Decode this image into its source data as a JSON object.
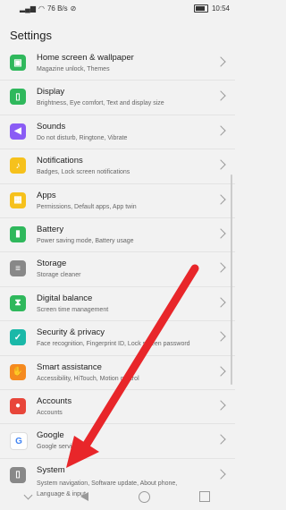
{
  "status": {
    "left_icons": "✦ ▮▮▮ ◉ 📶",
    "speed": "76 B/s",
    "battery_label": "",
    "time": "10:54"
  },
  "page_title": "Settings",
  "items": [
    {
      "label": "Home screen & wallpaper",
      "sub": "Magazine unlock, Themes",
      "color": "#2fb85c",
      "icon": "home-screen-icon",
      "glyph": "▣"
    },
    {
      "label": "Display",
      "sub": "Brightness, Eye comfort, Text and display size",
      "color": "#2fb85c",
      "icon": "display-icon",
      "glyph": "▯"
    },
    {
      "label": "Sounds",
      "sub": "Do not disturb, Ringtone, Vibrate",
      "color": "#8a5cf5",
      "icon": "sound-icon",
      "glyph": "◀"
    },
    {
      "label": "Notifications",
      "sub": "Badges, Lock screen notifications",
      "color": "#f6c11c",
      "icon": "bell-icon",
      "glyph": "♪"
    },
    {
      "label": "Apps",
      "sub": "Permissions, Default apps, App twin",
      "color": "#f6c11c",
      "icon": "apps-icon",
      "glyph": "▦"
    },
    {
      "label": "Battery",
      "sub": "Power saving mode, Battery usage",
      "color": "#2fb85c",
      "icon": "battery-icon",
      "glyph": "▮"
    },
    {
      "label": "Storage",
      "sub": "Storage cleaner",
      "color": "#888888",
      "icon": "storage-icon",
      "glyph": "≡"
    },
    {
      "label": "Digital balance",
      "sub": "Screen time management",
      "color": "#2fb85c",
      "icon": "hourglass-icon",
      "glyph": "⧗"
    },
    {
      "label": "Security & privacy",
      "sub": "Face recognition, Fingerprint ID, Lock screen password",
      "color": "#1ab8a8",
      "icon": "shield-icon",
      "glyph": "✓"
    },
    {
      "label": "Smart assistance",
      "sub": "Accessibility, HiTouch, Motion control",
      "color": "#f58a1f",
      "icon": "hand-icon",
      "glyph": "✋"
    },
    {
      "label": "Accounts",
      "sub": "Accounts",
      "color": "#e8463a",
      "icon": "account-icon",
      "glyph": "●"
    },
    {
      "label": "Google",
      "sub": "Google services",
      "color": "#ffffff",
      "icon": "google-icon",
      "glyph": "G"
    },
    {
      "label": "System",
      "sub": "System navigation, Software update, About phone, Language & input",
      "color": "#888888",
      "icon": "system-icon",
      "glyph": "▯"
    }
  ],
  "accent": "#e8262a"
}
